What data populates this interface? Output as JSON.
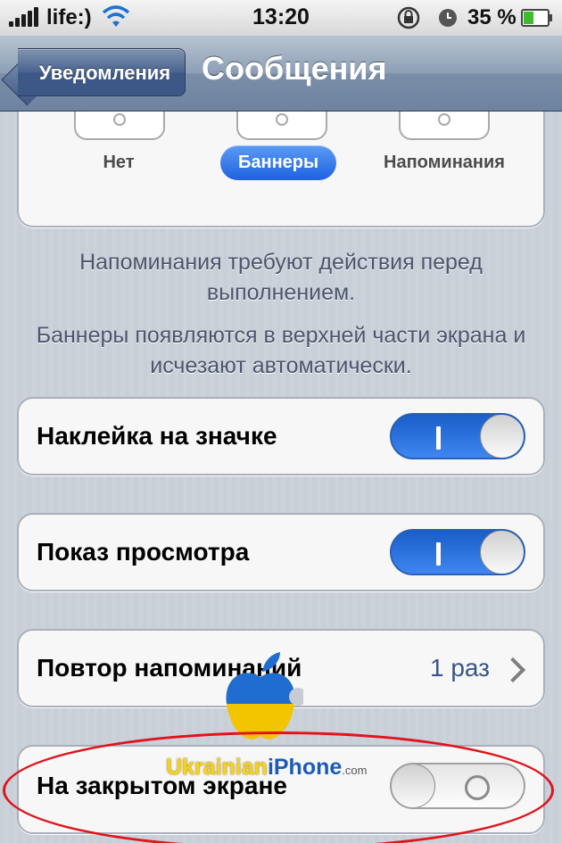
{
  "status_bar": {
    "carrier": "life:)",
    "time": "13:20",
    "battery_percent": "35 %",
    "icons": [
      "signal-icon",
      "wifi-icon",
      "rotation-lock-icon",
      "alarm-icon",
      "battery-icon"
    ]
  },
  "nav": {
    "back_label": "Уведомления",
    "title": "Сообщения"
  },
  "alert_style": {
    "options": [
      {
        "label": "Нет",
        "selected": false
      },
      {
        "label": "Баннеры",
        "selected": true
      },
      {
        "label": "Напоминания",
        "selected": false
      }
    ]
  },
  "footnote": {
    "line1": "Напоминания требуют действия перед выполнением.",
    "line2": "Баннеры появляются в верхней части экрана и исчезают автоматически."
  },
  "rows": {
    "badge": {
      "label": "Наклейка на значке",
      "value": true
    },
    "preview": {
      "label": "Показ просмотра",
      "value": true
    },
    "repeat": {
      "label": "Повтор напоминаний",
      "value": "1 раз"
    },
    "lock_screen": {
      "label": "На закрытом экране",
      "value": false
    }
  },
  "watermark": {
    "part1": "Ukrainian",
    "part2": "iPhone",
    "part3": ".com"
  },
  "colors": {
    "accent_blue": "#1f61e0",
    "highlight_red": "#e0141c"
  }
}
